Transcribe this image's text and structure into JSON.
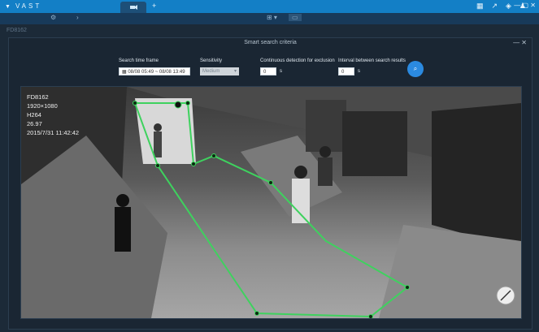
{
  "app": {
    "logo_text": "VAST",
    "tab_add": "+"
  },
  "subbar": {
    "tag": "FD8162"
  },
  "panel": {
    "title": "Smart search criteria",
    "search_time_frame": {
      "label": "Search time frame",
      "value": "08/08 05:49  ~  08/08 13:49"
    },
    "sensitivity": {
      "label": "Sensitivity",
      "value": "Medium"
    },
    "continuous": {
      "label": "Continuous detection for exclusion",
      "value": "0",
      "unit": "s"
    },
    "interval": {
      "label": "Interval between search results",
      "value": "0",
      "unit": "s"
    }
  },
  "video": {
    "overlay_lines": [
      "FD8162",
      "1920×1080",
      "H264",
      "26.97",
      "2015/7/31 11:42:42"
    ]
  },
  "colors": {
    "accent": "#137fc6",
    "polygon": "#3ed25e"
  },
  "icons": [
    "video-icon",
    "settings-icon",
    "layout-icon",
    "tag-icon",
    "chart-icon",
    "alert-icon",
    "search-icon",
    "calendar-icon",
    "expand-icon"
  ]
}
